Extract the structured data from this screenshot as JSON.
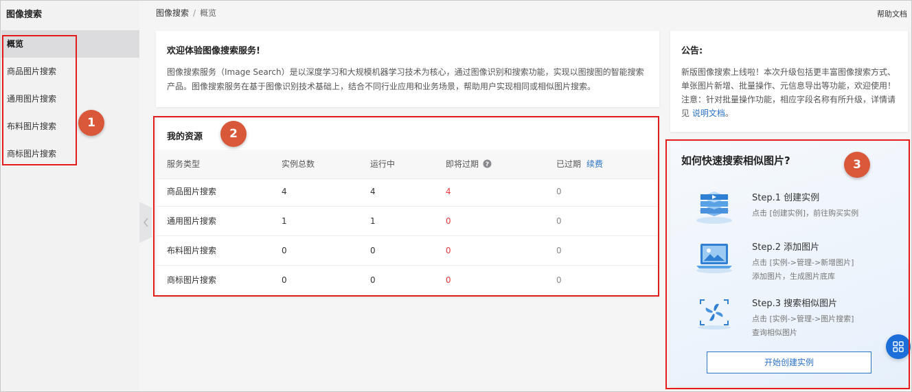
{
  "sidebar": {
    "title": "图像搜索",
    "items": [
      {
        "label": "概览",
        "active": true
      },
      {
        "label": "商品图片搜索"
      },
      {
        "label": "通用图片搜索"
      },
      {
        "label": "布料图片搜索"
      },
      {
        "label": "商标图片搜索"
      }
    ]
  },
  "header": {
    "breadcrumb": [
      "图像搜索",
      "概览"
    ],
    "breadcrumb_sep": "/",
    "help": "帮助文档"
  },
  "welcome": {
    "title": "欢迎体验图像搜索服务!",
    "body": "图像搜索服务（Image Search）是以深度学习和大规模机器学习技术为核心，通过图像识别和搜索功能，实现以图搜图的智能搜索产品。图像搜索服务在基于图像识别技术基础上，结合不同行业应用和业务场景，帮助用户实现相同或相似图片搜索。"
  },
  "notice": {
    "title": "公告:",
    "body": "新版图像搜索上线啦！本次升级包括更丰富图像搜索方式、单张图片新增、批量操作、元信息导出等功能，欢迎使用！注意：针对批量操作功能，相应字段名称有所升级，详情请见 ",
    "link": "说明文档",
    "tail": "。"
  },
  "resources": {
    "title": "我的资源",
    "columns": [
      "服务类型",
      "实例总数",
      "运行中",
      "即将过期",
      "已过期"
    ],
    "renew": "续费",
    "rows": [
      [
        "商品图片搜索",
        "4",
        "4",
        "4",
        "0"
      ],
      [
        "通用图片搜索",
        "1",
        "1",
        "0",
        "0"
      ],
      [
        "布料图片搜索",
        "0",
        "0",
        "0",
        "0"
      ],
      [
        "商标图片搜索",
        "0",
        "0",
        "0",
        "0"
      ]
    ]
  },
  "guide": {
    "title": "如何快速搜索相似图片?",
    "steps": [
      {
        "title": "Step.1 创建实例",
        "desc1": "点击 [创建实例]，前往购买实例",
        "desc2": "",
        "icon": "server-stack-icon"
      },
      {
        "title": "Step.2 添加图片",
        "desc1": "点击 [实例->管理->新增图片]",
        "desc2": "添加图片，生成图片底库",
        "icon": "laptop-image-icon"
      },
      {
        "title": "Step.3 搜索相似图片",
        "desc1": "点击 [实例->管理->图片搜索]",
        "desc2": "查询相似图片",
        "icon": "scan-pinwheel-icon"
      }
    ],
    "button": "开始创建实例"
  },
  "annotations": [
    "1",
    "2",
    "3"
  ],
  "colors": {
    "accent": "#2a72c6",
    "warning": "#e23a3a",
    "annotation": "#e21b1b",
    "badge": "#d9583a"
  }
}
